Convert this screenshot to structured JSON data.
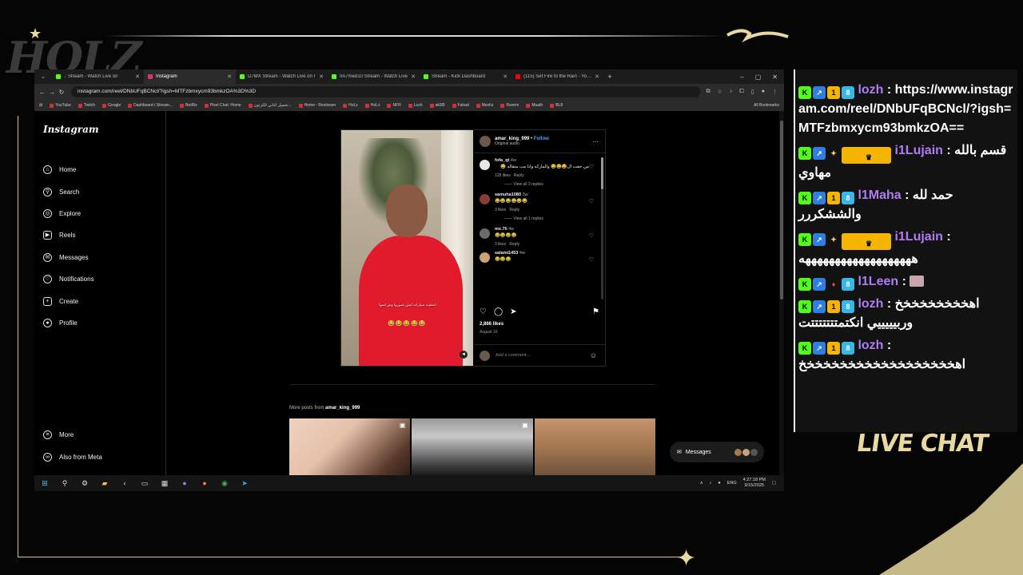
{
  "overlay": {
    "logo_text": "HOLZ",
    "live_chat_label": "LIVE CHAT"
  },
  "browser": {
    "tabs": [
      {
        "label": ".: Stream - Watch Live on",
        "color": "#53fc18",
        "active": false
      },
      {
        "label": "Instagram",
        "color": "#e1306c",
        "active": true
      },
      {
        "label": "D7MX Stream - Watch Live on I",
        "color": "#53fc18",
        "active": false
      },
      {
        "label": "IIA7med10 Stream - Watch Live",
        "color": "#53fc18",
        "active": false
      },
      {
        "label": "Stream - Kick Dashboard",
        "color": "#53fc18",
        "active": false
      },
      {
        "label": "(115) Set Fire to the Rain - YouTube",
        "color": "#ff0000",
        "active": false
      }
    ],
    "url": "instagram.com/reel/DNbUFqBCNcl/?igsh=MTFzbmxycm93bmkzOA%3D%3D",
    "bookmarks": [
      "YouTube",
      "Twitch",
      "Google",
      "Dashboard / Stream...",
      "BotRix",
      "Pixel Chat: Home",
      "تحميل اغاني الكرتون...",
      "Home - Restream",
      "HoLz",
      "HoLz",
      "NFR",
      "Lozh",
      "ak90l",
      "Fahad",
      "Meshz",
      "Rwerm",
      "Muath",
      "BL8"
    ],
    "all_bookmarks": "All Bookmarks"
  },
  "instagram": {
    "logo": "Instagram",
    "nav": [
      {
        "label": "Home",
        "icon": "home-icon"
      },
      {
        "label": "Search",
        "icon": "search-icon"
      },
      {
        "label": "Explore",
        "icon": "compass-icon"
      },
      {
        "label": "Reels",
        "icon": "reels-icon"
      },
      {
        "label": "Messages",
        "icon": "messenger-icon"
      },
      {
        "label": "Notifications",
        "icon": "heart-icon"
      },
      {
        "label": "Create",
        "icon": "plus-icon"
      },
      {
        "label": "Profile",
        "icon": "avatar-icon"
      }
    ],
    "bottom_nav": [
      {
        "label": "More",
        "icon": "menu-icon"
      },
      {
        "label": "Also from Meta",
        "icon": "meta-icon"
      }
    ],
    "post": {
      "author": "amar_king_999",
      "follow": "Follow",
      "audio": "Original audio",
      "subtitle": "اعطيت سيارات ليش تصوروا وش اسوا",
      "video_emoji": "😂😂😂😂😂",
      "comments": [
        {
          "user": "fofa_qt",
          "age": "4w",
          "text": "من جفت ال😂😂😂 والماركه وانا مب متقاله 😂",
          "likes": "128 likes",
          "reply": "Reply",
          "view": "View all 3 replies",
          "arabic": true
        },
        {
          "user": "samuha1080",
          "age": "3w",
          "text": "😂😂😂😂😂😂",
          "likes": "3 likes",
          "reply": "Reply",
          "view": "View all 1 replies",
          "arabic": false
        },
        {
          "user": "mx.7li",
          "age": "4w",
          "text": "😂😂😂😂",
          "likes": "3 likes",
          "reply": "Reply",
          "view": "",
          "arabic": false
        },
        {
          "user": "salami1453",
          "age": "4w",
          "text": "😂😂😂",
          "likes": "",
          "reply": "",
          "view": "",
          "arabic": false
        }
      ],
      "likes_total": "2,866 likes",
      "date": "August 16",
      "add_comment_placeholder": "Add a comment..."
    },
    "more_posts_prefix": "More posts from",
    "more_posts_user": "amar_king_999",
    "messages_label": "Messages"
  },
  "taskbar": {
    "lang": "ENG",
    "time": "4:27:18 PM",
    "date": "9/15/2025"
  },
  "chat": {
    "messages": [
      {
        "user": "lozh",
        "badges": [
          "K",
          "↗",
          "1",
          "8"
        ],
        "text": "https://www.instagram.com/reel/DNbUFqBCNcl/?igsh=MTFzbmxycm93bmkzOA=="
      },
      {
        "user": "i1Lujain",
        "badges": [
          "K",
          "↗",
          "✦",
          "♛"
        ],
        "text": "قسم بالله مهاوي"
      },
      {
        "user": "l1Maha",
        "badges": [
          "K",
          "↗",
          "1",
          "8"
        ],
        "text": "حمد لله والششكررر"
      },
      {
        "user": "i1Lujain",
        "badges": [
          "K",
          "↗",
          "✦",
          "♛"
        ],
        "text": "هههههههههههههههههههه"
      },
      {
        "user": "l1Leen",
        "badges": [
          "K",
          "↗",
          "♦",
          "8"
        ],
        "text": ""
      },
      {
        "user": "lozh",
        "badges": [
          "K",
          "↗",
          "1",
          "8"
        ],
        "text": "اهخخخخخخخخخ وربيييييي انكتمتتتتتتتت"
      },
      {
        "user": "lozh",
        "badges": [
          "K",
          "↗",
          "1",
          "8"
        ],
        "text": "اهخخخخخخخخخخخخخخخخخخخ"
      }
    ]
  }
}
